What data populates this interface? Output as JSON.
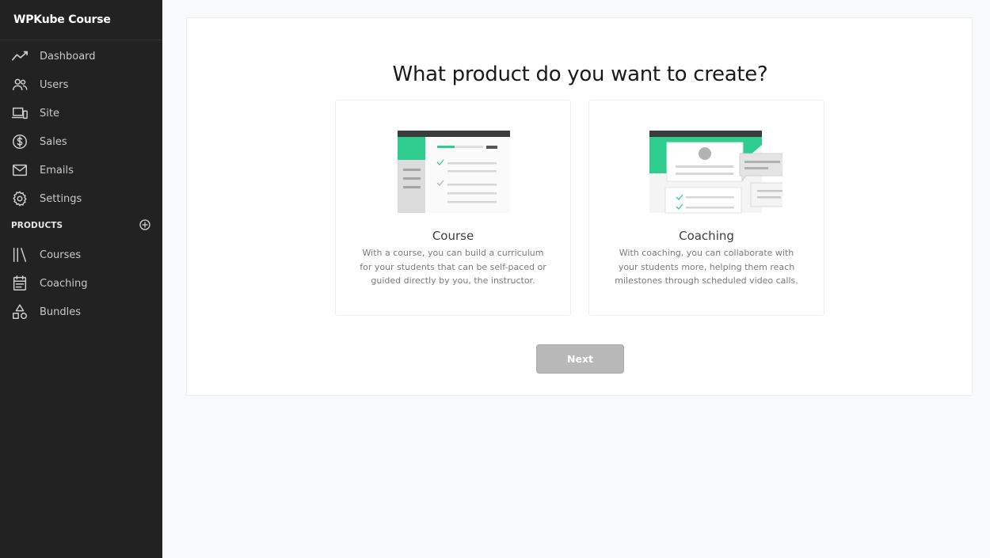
{
  "sidebar": {
    "brand": "WPKube Course",
    "items": [
      {
        "label": "Dashboard",
        "icon": "trend-line-icon"
      },
      {
        "label": "Users",
        "icon": "users-icon"
      },
      {
        "label": "Site",
        "icon": "devices-icon"
      },
      {
        "label": "Sales",
        "icon": "dollar-circle-icon"
      },
      {
        "label": "Emails",
        "icon": "envelope-icon"
      },
      {
        "label": "Settings",
        "icon": "gear-icon"
      }
    ],
    "products_section": {
      "title": "PRODUCTS",
      "add_icon": "plus-circle-icon",
      "items": [
        {
          "label": "Courses",
          "icon": "library-icon"
        },
        {
          "label": "Coaching",
          "icon": "calendar-icon"
        },
        {
          "label": "Bundles",
          "icon": "shapes-icon"
        }
      ]
    }
  },
  "main": {
    "title": "What product do you want to create?",
    "options": [
      {
        "title": "Course",
        "description": "With a course, you can build a curriculum for your students that can be self-paced or guided directly by you, the instructor."
      },
      {
        "title": "Coaching",
        "description": "With coaching, you can collaborate with your students more, helping them reach milestones through scheduled video calls."
      }
    ],
    "next_label": "Next"
  },
  "colors": {
    "sidebar_bg": "#222222",
    "accent": "#2ecc8f",
    "button_disabled": "#b8b8b8"
  }
}
